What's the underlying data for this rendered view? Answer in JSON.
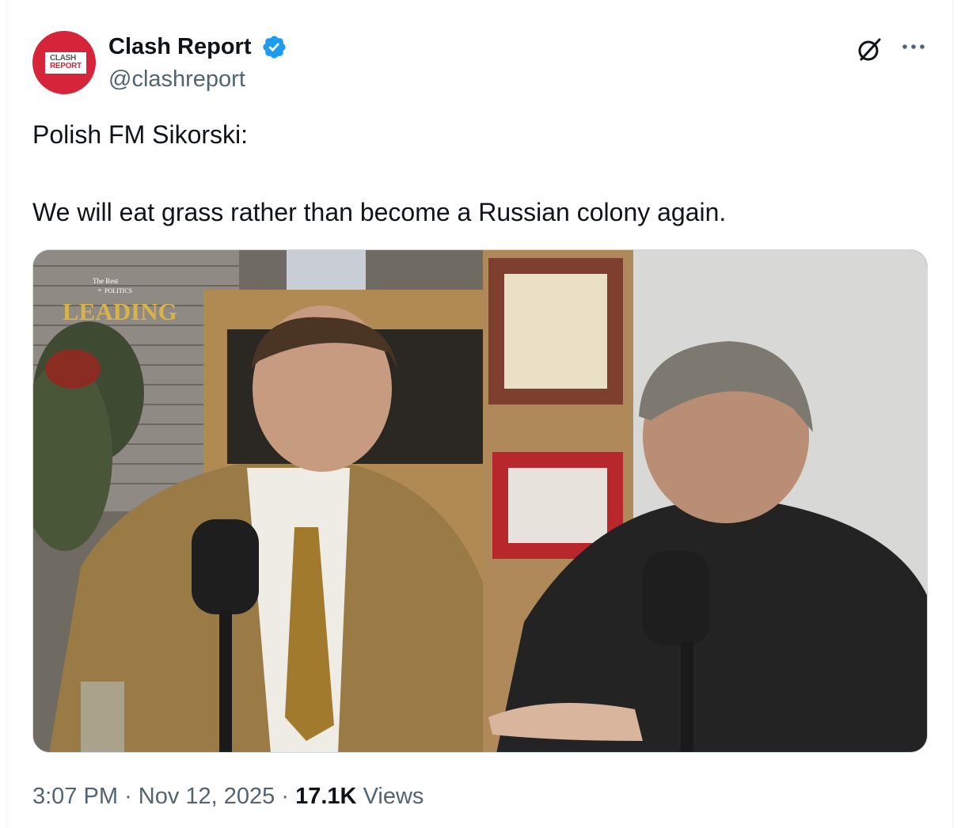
{
  "tweet": {
    "author": {
      "name": "Clash Report",
      "handle": "@clashreport",
      "verified": true,
      "avatar_text": [
        "CLASH",
        "REPORT"
      ],
      "avatar_color": "#d6243a"
    },
    "text_lines": [
      "Polish FM Sikorski:",
      "We will eat grass rather than become a Russian colony again."
    ],
    "media": {
      "type": "video",
      "overlay_small": [
        "The Rest",
        "is",
        "POLITICS"
      ],
      "overlay_title": "LEADING"
    },
    "time": "3:07 PM",
    "date": "Nov 12, 2025",
    "separator": "·",
    "views_count": "17.1K",
    "views_label": "Views"
  },
  "icons": {
    "verified": "verified-badge-icon",
    "grok": "grok-icon",
    "more": "more-icon"
  },
  "colors": {
    "verified": "#1d9bf0",
    "secondary_text": "#536471",
    "primary_text": "#0f1419",
    "overlay_title": "#d9b24a"
  }
}
